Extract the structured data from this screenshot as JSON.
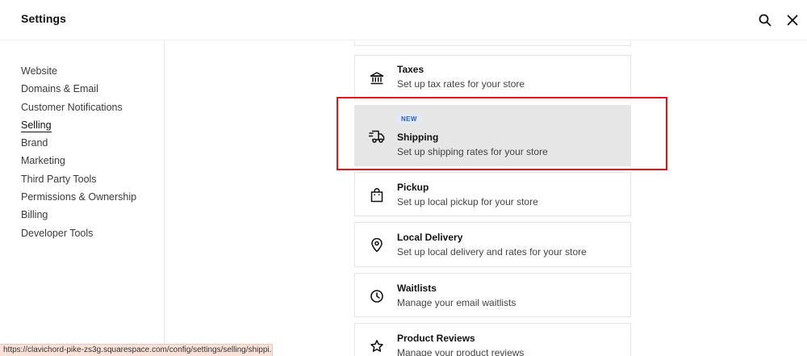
{
  "header": {
    "title": "Settings",
    "search_icon": "search-icon",
    "close_icon": "close-icon"
  },
  "sidebar": {
    "items": [
      {
        "label": "Website"
      },
      {
        "label": "Domains & Email"
      },
      {
        "label": "Customer Notifications"
      },
      {
        "label": "Selling",
        "active": true
      },
      {
        "label": "Brand"
      },
      {
        "label": "Marketing"
      },
      {
        "label": "Third Party Tools"
      },
      {
        "label": "Permissions & Ownership"
      },
      {
        "label": "Billing"
      },
      {
        "label": "Developer Tools"
      }
    ]
  },
  "cards": [
    {
      "icon": "bank-icon",
      "title": "Taxes",
      "description": "Set up tax rates for your store"
    },
    {
      "icon": "truck-icon",
      "title": "Shipping",
      "description": "Set up shipping rates for your store",
      "badge": "NEW"
    },
    {
      "icon": "shopping-bag-icon",
      "title": "Pickup",
      "description": "Set up local pickup for your store"
    },
    {
      "icon": "location-pin-icon",
      "title": "Local Delivery",
      "description": "Set up local delivery and rates for your store"
    },
    {
      "icon": "clock-icon",
      "title": "Waitlists",
      "description": "Manage your email waitlists"
    },
    {
      "icon": "star-icon",
      "title": "Product Reviews",
      "description": "Manage your product reviews"
    }
  ],
  "status_bar": {
    "url": "https://clavichord-pike-zs3g.squarespace.com/config/settings/selling/shippi..."
  },
  "colors": {
    "highlight_outline": "#e8141b",
    "selected_card_bg": "#e6e6e6",
    "badge_bg": "#dfe9fb",
    "badge_text": "#2b5fb8"
  }
}
